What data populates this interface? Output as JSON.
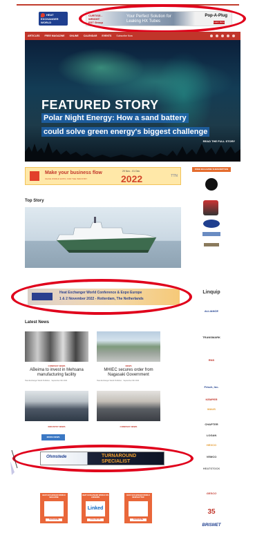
{
  "header": {
    "logo": {
      "line1": "HEAT",
      "line2": "EXCHANGER",
      "line3": "WORLD"
    },
    "ad": {
      "brand_line1": "CURTISS -",
      "brand_line2": "WRIGHT",
      "brand_line3": "EST Group",
      "tagline": "Your Perfect Solution for Leaking HX Tubes",
      "product": "Pop-A-Plug",
      "cta": "Learn More"
    }
  },
  "nav": {
    "items": [
      "ARTICLES",
      "FREE MAGAZINE",
      "ONLINE",
      "CALENDAR",
      "EVENTS",
      "Subscribe Now"
    ],
    "social": [
      "facebook-icon",
      "linkedin-icon",
      "twitter-icon",
      "youtube-icon",
      "rss-icon"
    ]
  },
  "hero": {
    "kicker": "FEATURED STORY",
    "headline_line1": "Polar Night Energy: How a sand battery",
    "headline_line2": "could solve green energy's biggest challenge",
    "read_more": "READ THE FULL STORY"
  },
  "banner_2022": {
    "title": "Make your business flow",
    "sub": "VALVE WORLD EXPO, FOR THE INDUSTRY",
    "dates": "29 Nov - 01 Dec",
    "year": "2022",
    "brand": "TTN"
  },
  "sidebar": {
    "subscribe": "FREE MAGAZINE SUBSCRIPTION",
    "logos": [
      "Linquip",
      "ALLIANCE",
      "TRANSMARK",
      "RNS",
      "Frisch, Inc.",
      "KEMPER",
      "MAUS",
      "CHAPTER",
      "LOGAN",
      "HEXCO",
      "VEMCO",
      "HEATSTOCK"
    ],
    "bottom_logos": [
      "GESCO",
      "35",
      "BRISMET"
    ]
  },
  "top_story": {
    "title": "Top Story"
  },
  "conference": {
    "line1": "Heat Exchanger World Conference & Expo Europe",
    "line2": "1 & 2 November 2022 - Rotterdam, The Netherlands"
  },
  "latest_news": {
    "title": "Latest News",
    "items": [
      {
        "category": "COMPANY NEWS",
        "title": "ABeima to invest in Mehsana manufacturing facility",
        "author": "Heat Exchanger World Publisher",
        "date": "September 6th 2022"
      },
      {
        "category": "NEWS",
        "title": "MHIEC secures order from Nagasaki Government",
        "author": "Heat Exchanger World Publisher",
        "date": "September 6th 2022"
      },
      {
        "category": "INDUSTRY NEWS",
        "title": "",
        "author": "",
        "date": ""
      },
      {
        "category": "COMPANY NEWS",
        "title": "",
        "author": "",
        "date": ""
      }
    ],
    "more_button": "MORE NEWS"
  },
  "bottom_ad": {
    "brand": "Ohmstede",
    "line1": "TURNAROUND",
    "line2": "SPECIALIST"
  },
  "magazines": [
    {
      "caption": "HEAT EXCHANGER WORLD MAGAZINE",
      "button": "SUBSCRIBE"
    },
    {
      "caption": "HEAT EXCHANGER WORLD ON LINKEDIN",
      "linkedin": "Linked",
      "button": "FOLLOW US"
    },
    {
      "caption": "HEAT EXCHANGER WORLD NEWSLETTER",
      "button": "SUBSCRIBE"
    }
  ]
}
